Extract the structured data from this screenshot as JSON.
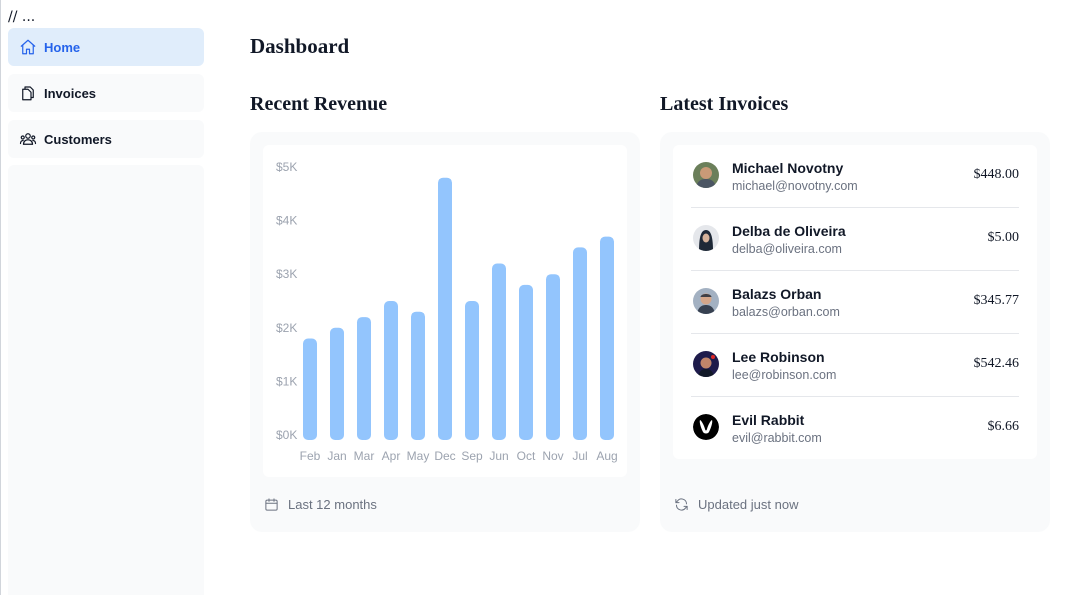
{
  "header": {
    "comment": "// ..."
  },
  "sidebar": {
    "items": [
      {
        "label": "Home",
        "icon": "home-icon",
        "active": true
      },
      {
        "label": "Invoices",
        "icon": "document-duplicate-icon",
        "active": false
      },
      {
        "label": "Customers",
        "icon": "user-group-icon",
        "active": false
      }
    ]
  },
  "main": {
    "title": "Dashboard",
    "revenue": {
      "title": "Recent Revenue",
      "footer": "Last 12 months",
      "footer_icon": "calendar-icon"
    },
    "invoices": {
      "title": "Latest Invoices",
      "footer": "Updated just now",
      "footer_icon": "refresh-icon",
      "rows": [
        {
          "name": "Michael Novotny",
          "email": "michael@novotny.com",
          "amount": "$448.00",
          "avatar": "avatar-photo"
        },
        {
          "name": "Delba de Oliveira",
          "email": "delba@oliveira.com",
          "amount": "$5.00",
          "avatar": "avatar-photo"
        },
        {
          "name": "Balazs Orban",
          "email": "balazs@orban.com",
          "amount": "$345.77",
          "avatar": "avatar-photo"
        },
        {
          "name": "Lee Robinson",
          "email": "lee@robinson.com",
          "amount": "$542.46",
          "avatar": "avatar-photo"
        },
        {
          "name": "Evil Rabbit",
          "email": "evil@rabbit.com",
          "amount": "$6.66",
          "avatar": "rabbit-logo"
        }
      ]
    }
  },
  "colors": {
    "accent": "#2563eb",
    "bar": "#93c5fd",
    "active_nav_bg": "#e0edfb",
    "card_bg": "#f9fafb"
  },
  "chart_data": {
    "type": "bar",
    "title": "Recent Revenue",
    "xlabel": "",
    "ylabel": "",
    "categories": [
      "Feb",
      "Jan",
      "Mar",
      "Apr",
      "May",
      "Dec",
      "Sep",
      "Jun",
      "Oct",
      "Nov",
      "Jul",
      "Aug"
    ],
    "values": [
      1800,
      2000,
      2200,
      2500,
      2300,
      4800,
      2500,
      3200,
      2800,
      3000,
      3500,
      3700
    ],
    "yticks": [
      "$0K",
      "$1K",
      "$2K",
      "$3K",
      "$4K",
      "$5K"
    ],
    "ylim": [
      0,
      5000
    ],
    "grid": false,
    "legend": "none"
  }
}
